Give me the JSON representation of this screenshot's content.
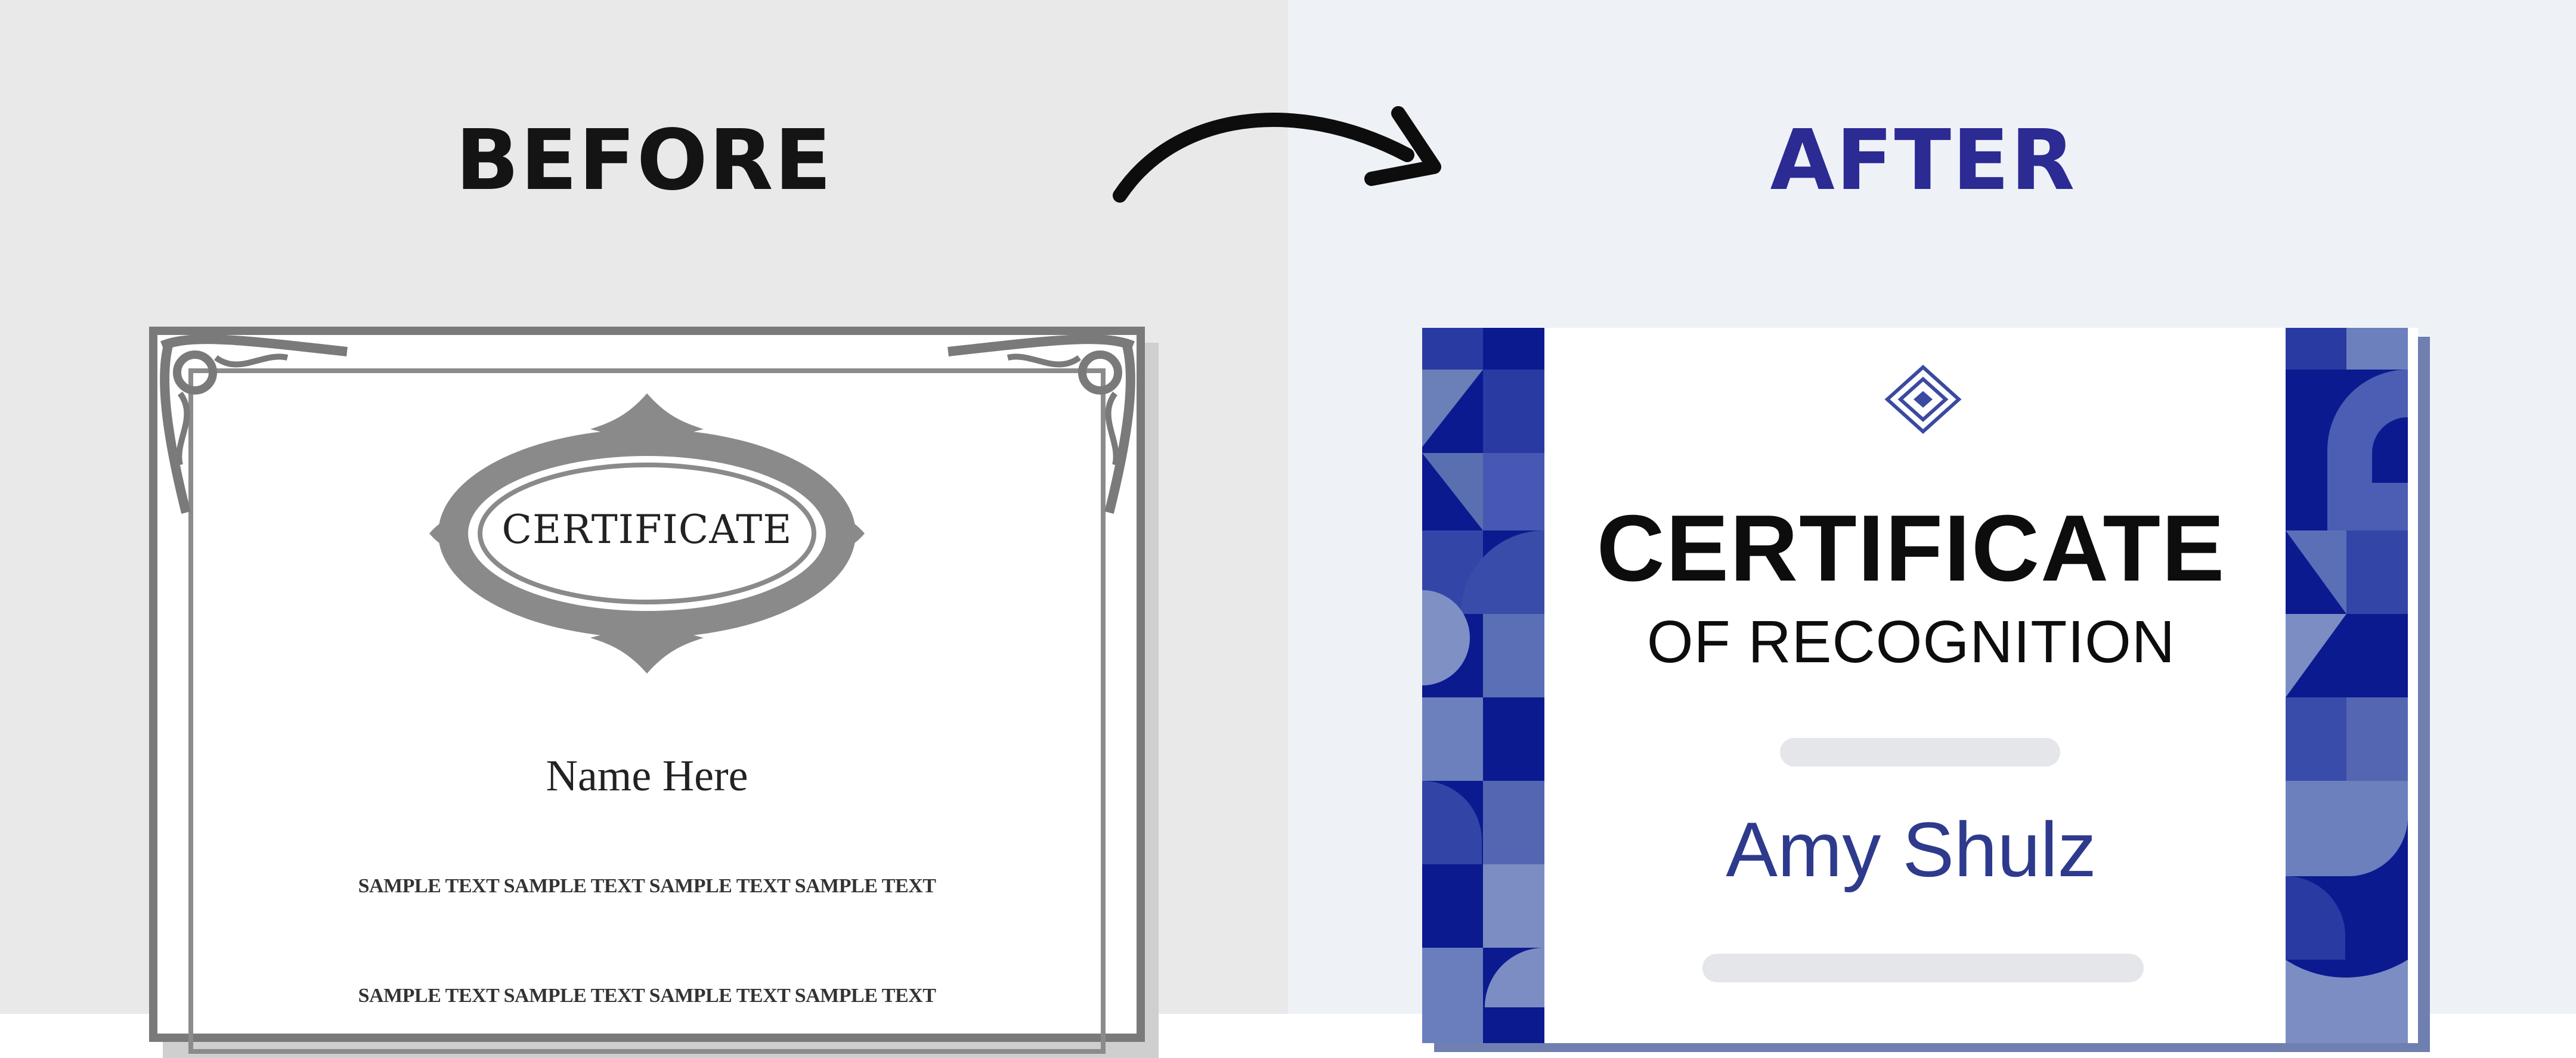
{
  "headings": {
    "before": "BEFORE",
    "after": "AFTER"
  },
  "before_certificate": {
    "title": "CERTIFICATE",
    "name": "Name Here",
    "sample_line_1": "SAMPLE TEXT SAMPLE TEXT SAMPLE TEXT SAMPLE TEXT",
    "sample_line_2": "SAMPLE TEXT SAMPLE TEXT SAMPLE TEXT SAMPLE TEXT"
  },
  "after_certificate": {
    "title": "CERTIFICATE",
    "subtitle": "OF RECOGNITION",
    "name": "Amy Shulz"
  },
  "icons": [
    "arrow-right-curved-icon",
    "diamond-logo-icon",
    "ornament-frame-icon"
  ],
  "colors": {
    "before_bg": "#e9e9ea",
    "after_bg": "#eef2f7",
    "after_heading": "#2c2a93",
    "brand_blue": "#0b1a8f",
    "name_blue": "#2e3a8c"
  }
}
